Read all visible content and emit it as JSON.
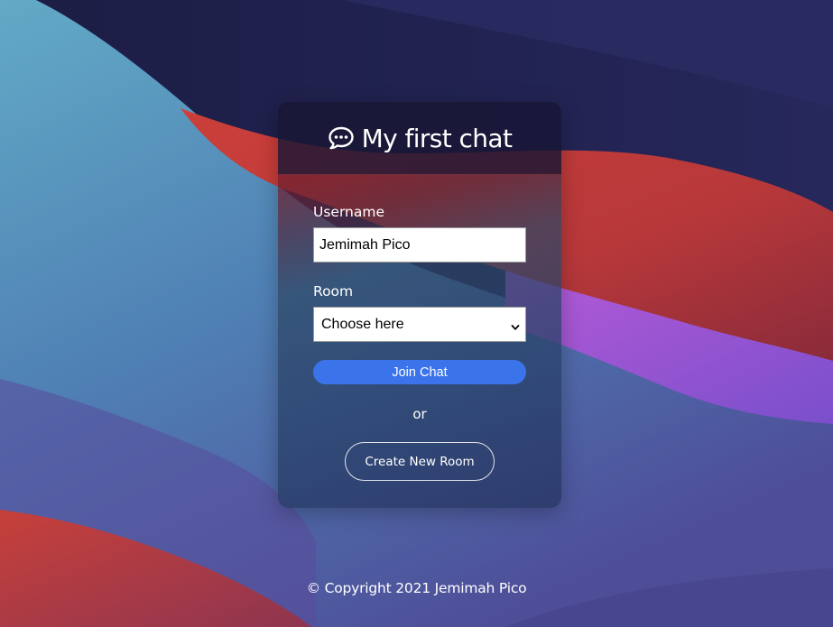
{
  "app": {
    "title": "My first chat",
    "title_icon": "chat-bubble-icon"
  },
  "form": {
    "username": {
      "label": "Username",
      "value": "Jemimah Pico"
    },
    "room": {
      "label": "Room",
      "selected": "Choose here",
      "icon": "chevron-down-icon"
    },
    "join_label": "Join Chat",
    "or_text": "or",
    "create_label": "Create New Room"
  },
  "footer": {
    "text": "© Copyright 2021 Jemimah Pico"
  },
  "colors": {
    "accent": "#3b73ea",
    "background_dark": "#24234f",
    "wave_red": "#c23b3b",
    "wave_blue": "#5aa6c4",
    "wave_purple": "#9a56d8"
  }
}
